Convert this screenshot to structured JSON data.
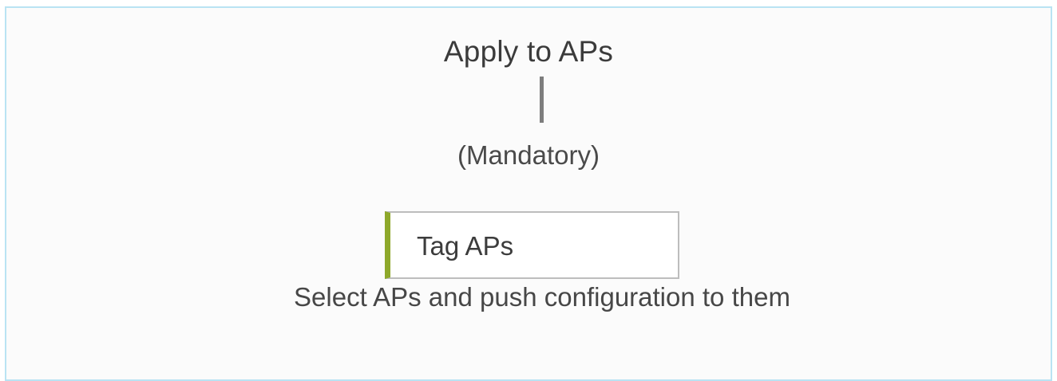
{
  "step": {
    "title": "Apply to APs",
    "requirement": "(Mandatory)"
  },
  "action": {
    "button_label": "Tag APs",
    "description": "Select APs and push configuration to them",
    "accent_color": "#8ea82a"
  },
  "frame": {
    "border_color": "#b9e3f3"
  }
}
